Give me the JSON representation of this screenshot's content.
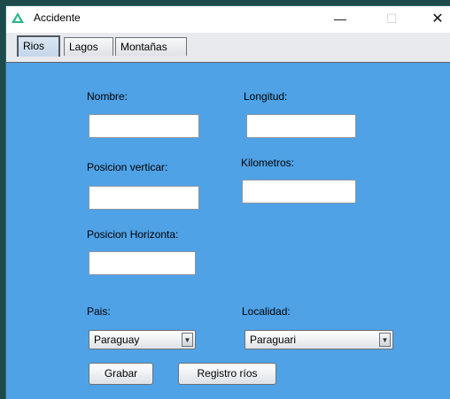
{
  "window": {
    "title": "Accidente",
    "minimize": "—",
    "maximize": "☐",
    "close": "✕"
  },
  "tabs": [
    {
      "label": "Rios",
      "selected": true
    },
    {
      "label": "Lagos",
      "selected": false
    },
    {
      "label": "Montañas",
      "selected": false
    }
  ],
  "form": {
    "nombre_label": "Nombre:",
    "longitud_label": "Longitud:",
    "posicion_vertical_label": "Posicion verticar:",
    "kilometros_label": "Kilometros:",
    "posicion_horizontal_label": "Posicion Horizonta:",
    "pais_label": "Pais:",
    "localidad_label": "Localidad:",
    "nombre_value": "",
    "longitud_value": "",
    "posicion_vertical_value": "",
    "kilometros_value": "",
    "posicion_horizontal_value": "",
    "pais_selected": "Paraguay",
    "localidad_selected": "Paraguari",
    "dropdown_arrow": "▼",
    "grabar_label": "Grabar",
    "registro_label": "Registro ríos"
  },
  "colors": {
    "panel": "#4fa2e6",
    "icon": "#2bb58a"
  }
}
